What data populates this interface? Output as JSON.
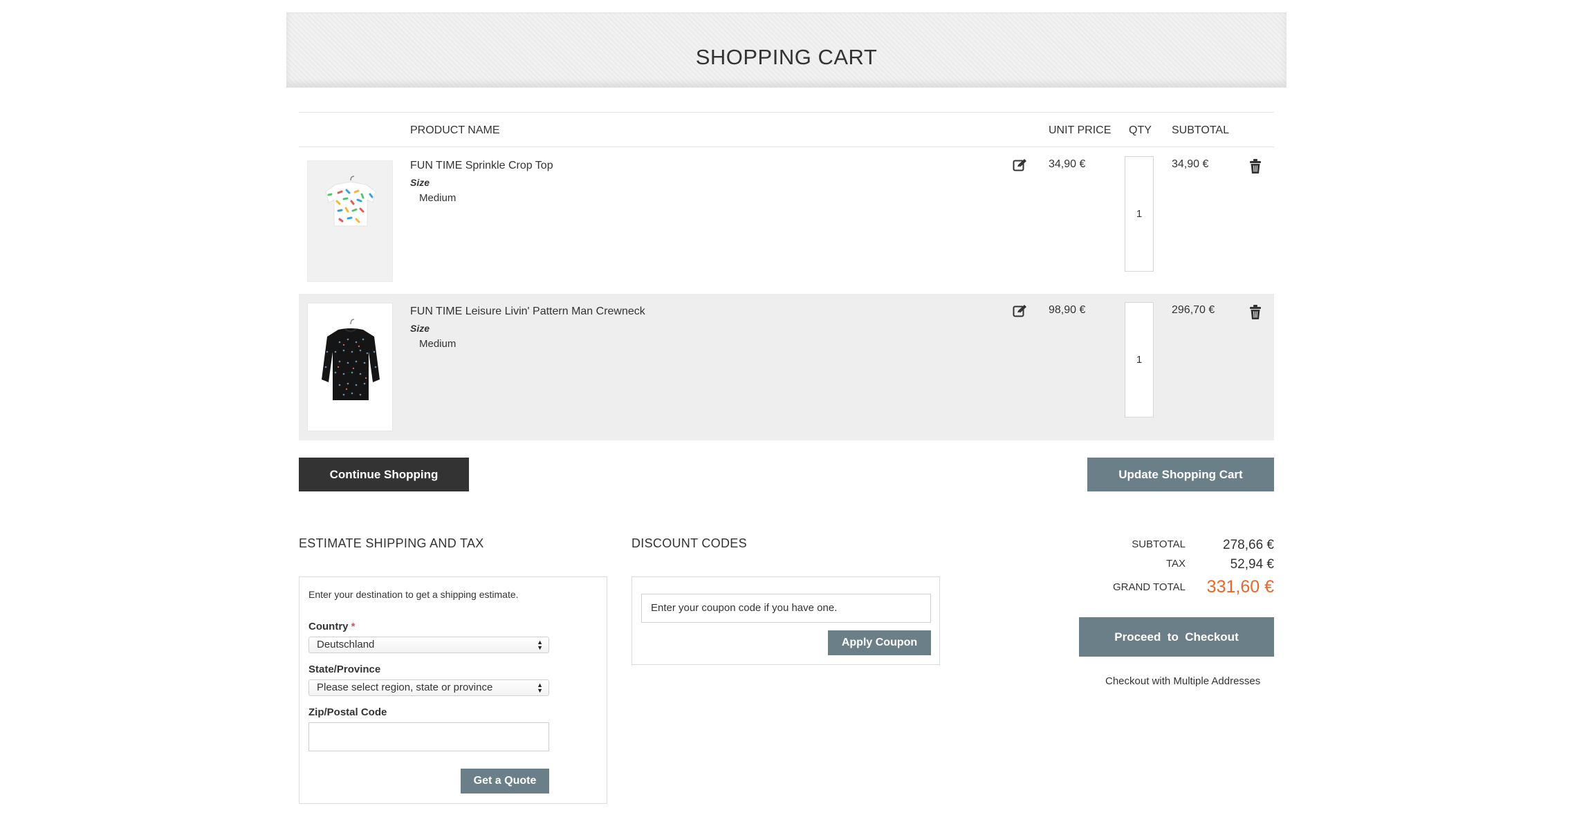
{
  "page": {
    "title": "SHOPPING CART"
  },
  "table": {
    "headers": {
      "product_name": "PRODUCT NAME",
      "unit_price": "UNIT PRICE",
      "qty": "QTY",
      "subtotal": "SUBTOTAL"
    },
    "items": [
      {
        "name": "FUN TIME Sprinkle Crop Top",
        "size_label": "Size",
        "size_value": "Medium",
        "unit_price": "34,90 €",
        "qty": "1",
        "subtotal": "34,90 €",
        "image": "white-crop-top-with-sprinkles"
      },
      {
        "name": "FUN TIME Leisure Livin' Pattern Man Crewneck",
        "size_label": "Size",
        "size_value": "Medium",
        "unit_price": "98,90 €",
        "qty": "1",
        "subtotal": "296,70 €",
        "image": "black-crewneck-sweater"
      }
    ]
  },
  "actions": {
    "continue_shopping": "Continue Shopping",
    "update_cart": "Update Shopping Cart"
  },
  "shipping": {
    "title": "ESTIMATE SHIPPING AND TAX",
    "intro": "Enter your destination to get a shipping estimate.",
    "country_label": "Country",
    "country_required_mark": "*",
    "country_value": "Deutschland",
    "state_label": "State/Province",
    "state_value": "Please select region, state or province",
    "zip_label": "Zip/Postal Code",
    "zip_value": "",
    "quote_button": "Get a Quote"
  },
  "discount": {
    "title": "DISCOUNT CODES",
    "placeholder": "Enter your coupon code if you have one.",
    "apply_button": "Apply Coupon"
  },
  "totals": {
    "subtotal_label": "SUBTOTAL",
    "subtotal_value": "278,66 €",
    "tax_label": "TAX",
    "tax_value": "52,94 €",
    "grand_total_label": "GRAND TOTAL",
    "grand_total_value": "331,60 €",
    "checkout_button": "Proceed  to  Checkout",
    "multi_address_link": "Checkout with Multiple Addresses"
  },
  "colors": {
    "accent_orange": "#e2692f",
    "button_slate": "#6b7f89",
    "button_dark": "#333333"
  }
}
